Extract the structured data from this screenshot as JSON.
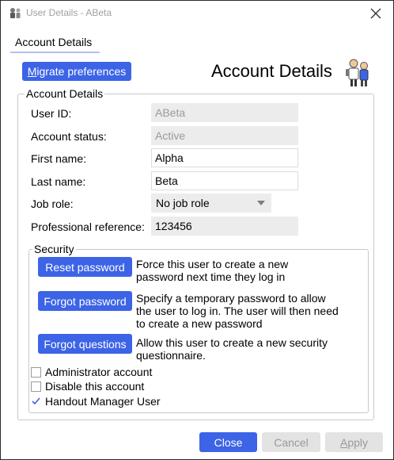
{
  "window": {
    "title": "User Details - ABeta"
  },
  "tab": {
    "label": "Account Details"
  },
  "toolbar": {
    "migrate_label": "Migrate preferences"
  },
  "header": {
    "heading": "Account Details"
  },
  "account": {
    "legend": "Account Details",
    "user_id_label": "User ID:",
    "user_id_value": "ABeta",
    "status_label": "Account status:",
    "status_value": "Active",
    "first_name_label": "First name:",
    "first_name_value": "Alpha",
    "last_name_label": "Last name:",
    "last_name_value": "Beta",
    "job_role_label": "Job role:",
    "job_role_value": "No job role",
    "prof_ref_label": "Professional reference:",
    "prof_ref_value": "123456"
  },
  "security": {
    "legend": "Security",
    "reset_label": "Reset password",
    "reset_desc_1": "Force this user to create a new",
    "reset_desc_2": "password next time they log in",
    "forgot_label": "Forgot password",
    "forgot_desc_1": "Specify a temporary password to allow",
    "forgot_desc_2": "the user to log in. The user will then need",
    "forgot_desc_3": "to create a new password",
    "questions_label": "Forgot questions",
    "questions_desc_1": "Allow this user to create a new security",
    "questions_desc_2": "questionnaire.",
    "admin_label": "Administrator account",
    "admin_checked": false,
    "disable_label": "Disable this account",
    "disable_checked": false,
    "handout_label": "Handout Manager User",
    "handout_checked": true
  },
  "footer": {
    "close_label": "Close",
    "cancel_label": "Cancel",
    "apply_label": "Apply"
  },
  "colors": {
    "accent": "#3d64e6",
    "disabled_bg": "#e3e3e3",
    "readonly_bg": "#ececec"
  }
}
